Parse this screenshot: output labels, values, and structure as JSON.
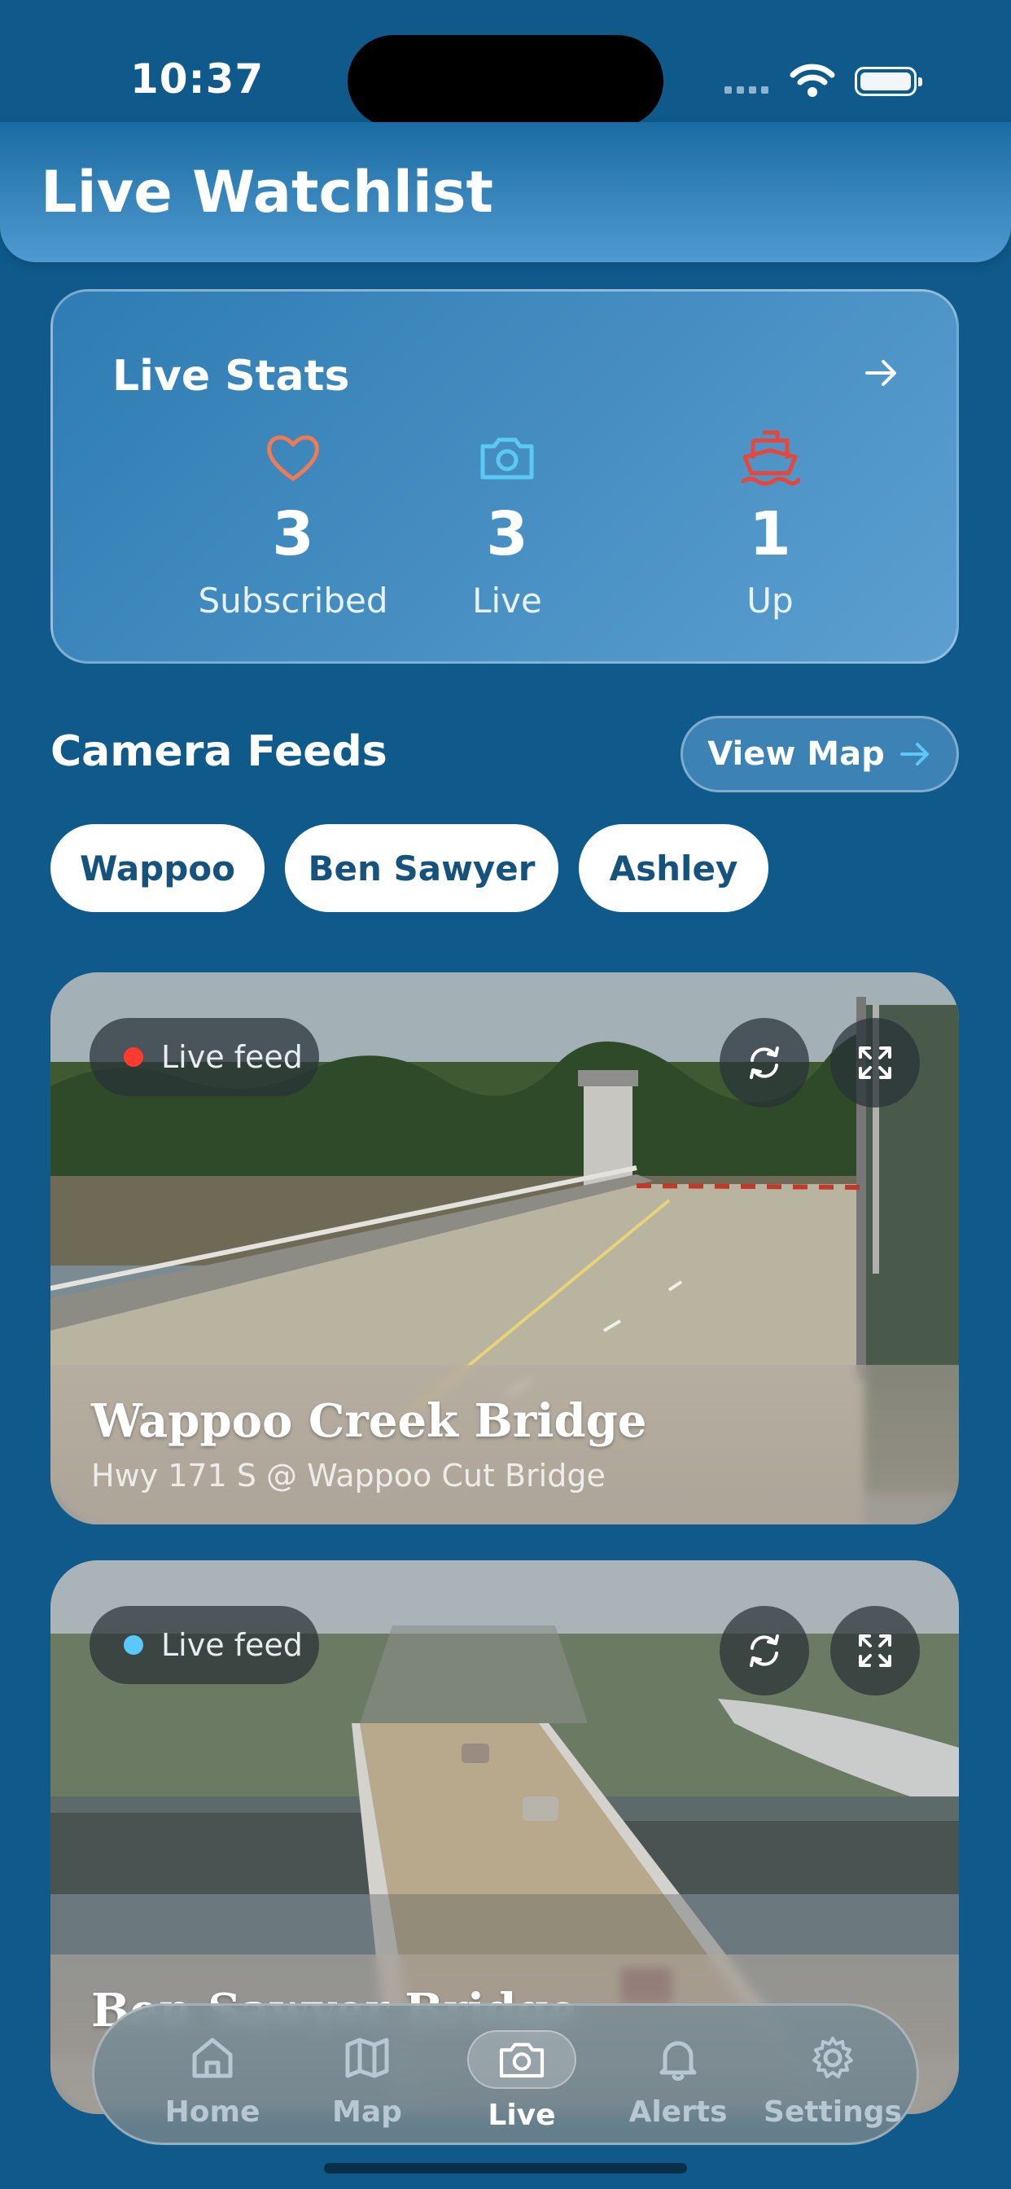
{
  "status_bar": {
    "time": "10:37"
  },
  "header": {
    "title": "Live Watchlist"
  },
  "stats": {
    "title": "Live Stats",
    "items": [
      {
        "icon": "heart-icon",
        "value": "3",
        "label": "Subscribed",
        "color": "#f07b52"
      },
      {
        "icon": "camera-icon",
        "value": "3",
        "label": "Live",
        "color": "#5bc8f5"
      },
      {
        "icon": "ship-icon",
        "value": "1",
        "label": "Up",
        "color": "#e8453c"
      }
    ]
  },
  "feeds_section": {
    "title": "Camera Feeds",
    "view_map_label": "View Map",
    "chips": [
      "Wappoo",
      "Ben Sawyer",
      "Ashley"
    ]
  },
  "feeds": [
    {
      "badge": "Live feed",
      "badge_color": "#ff3b30",
      "name": "Wappoo Creek Bridge",
      "subtitle": "Hwy 171 S @ Wappoo Cut Bridge"
    },
    {
      "badge": "Live feed",
      "badge_color": "#5ac8fa",
      "name": "Ben Sawyer Bridge",
      "subtitle": ""
    }
  ],
  "tabbar": {
    "items": [
      {
        "icon": "home-icon",
        "label": "Home"
      },
      {
        "icon": "map-icon",
        "label": "Map"
      },
      {
        "icon": "camera-icon",
        "label": "Live"
      },
      {
        "icon": "bell-icon",
        "label": "Alerts"
      },
      {
        "icon": "gear-icon",
        "label": "Settings"
      }
    ],
    "active": "Live"
  },
  "colors": {
    "background": "#0f5a8b",
    "accent": "#15527d"
  }
}
